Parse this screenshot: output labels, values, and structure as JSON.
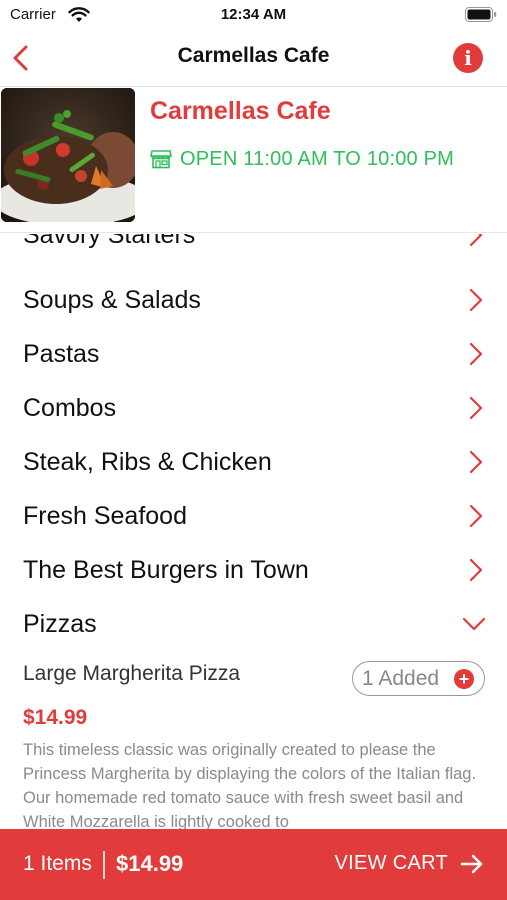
{
  "status_bar": {
    "carrier": "Carrier",
    "time": "12:34 AM"
  },
  "nav": {
    "title": "Carmellas Cafe",
    "back_icon": "chevron-left-icon",
    "info_icon": "info-icon",
    "info_glyph": "i"
  },
  "restaurant": {
    "name": "Carmellas Cafe",
    "hours": "OPEN 11:00 AM TO 10:00 PM",
    "hours_icon": "store-icon"
  },
  "menu": {
    "categories": [
      {
        "label": "Savory Starters",
        "expanded": false
      },
      {
        "label": "Soups & Salads",
        "expanded": false
      },
      {
        "label": "Pastas",
        "expanded": false
      },
      {
        "label": "Combos",
        "expanded": false
      },
      {
        "label": "Steak, Ribs & Chicken",
        "expanded": false
      },
      {
        "label": "Fresh Seafood",
        "expanded": false
      },
      {
        "label": "The Best Burgers in Town",
        "expanded": false
      },
      {
        "label": "Pizzas",
        "expanded": true
      }
    ],
    "expanded_item": {
      "name": "Large Margherita Pizza",
      "added_label": "1 Added",
      "add_glyph": "+",
      "price": "$14.99",
      "description": "This timeless classic was originally created to please the Princess Margherita by displaying the colors of the Italian flag. Our homemade red tomato sauce with fresh sweet basil and White Mozzarella is lightly cooked to"
    }
  },
  "cart": {
    "count": "1 Items",
    "total": "$14.99",
    "view_label": "VIEW CART"
  },
  "colors": {
    "accent": "#e23b3b",
    "open_green": "#2fbf5a"
  }
}
